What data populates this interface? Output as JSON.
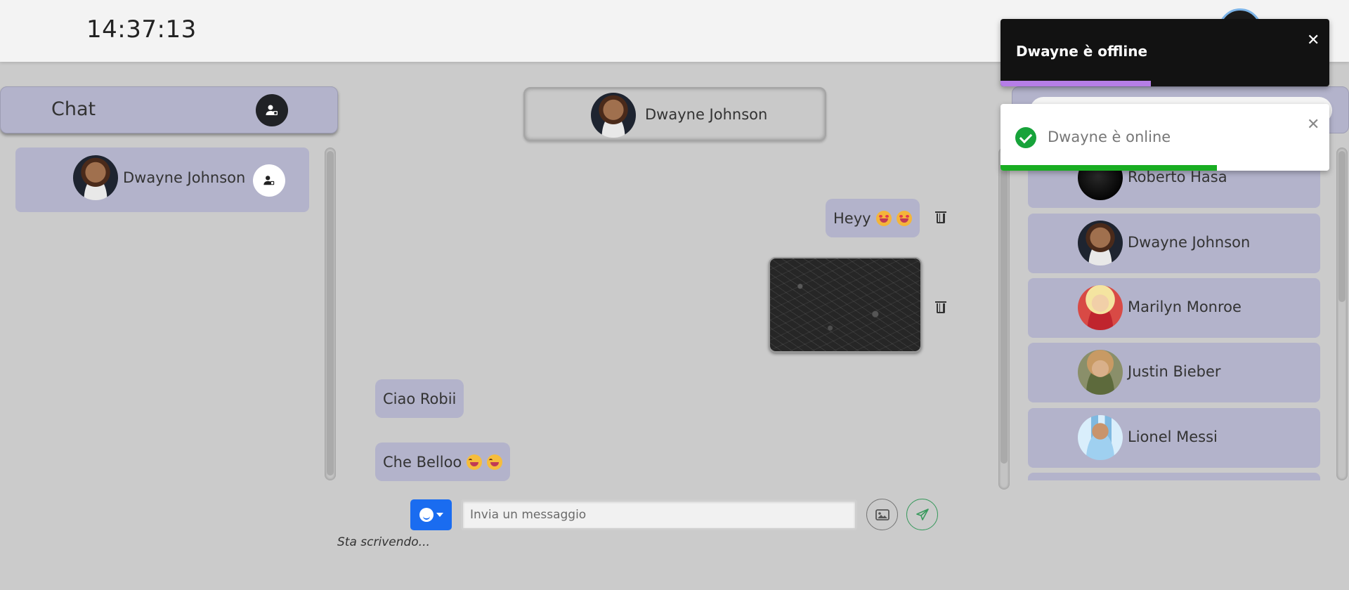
{
  "header": {
    "clock": "14:37:13"
  },
  "left_panel": {
    "title": "Chat",
    "contacts": [
      {
        "name": "Dwayne Johnson"
      }
    ]
  },
  "chat": {
    "contact_name": "Dwayne Johnson",
    "messages": [
      {
        "side": "sent",
        "text": "Heyy"
      },
      {
        "side": "sent",
        "type": "image"
      },
      {
        "side": "received",
        "text": "Ciao Robii"
      },
      {
        "side": "received",
        "text": "Che Belloo"
      }
    ],
    "input_placeholder": "Invia un messaggio",
    "typing_status": "Sta scrivendo..."
  },
  "right_panel": {
    "users": [
      {
        "name": "Roberto Hasa"
      },
      {
        "name": "Dwayne Johnson"
      },
      {
        "name": "Marilyn Monroe"
      },
      {
        "name": "Justin Bieber"
      },
      {
        "name": "Lionel Messi"
      }
    ]
  },
  "toasts": [
    {
      "text": "Dwayne è offline",
      "theme": "dark",
      "progress": 0.46,
      "accent": "#b57ee6"
    },
    {
      "text": "Dwayne è online",
      "theme": "light",
      "progress": 0.66,
      "accent": "#19ad22"
    }
  ],
  "icons": [
    "add-user-icon",
    "trash-icon",
    "emoji-icon",
    "image-icon",
    "send-icon",
    "close-icon",
    "check-icon"
  ],
  "colors": {
    "panel": "#b3b3cb",
    "background": "#cbcbcb",
    "emoji_button": "#1a6cf0"
  }
}
